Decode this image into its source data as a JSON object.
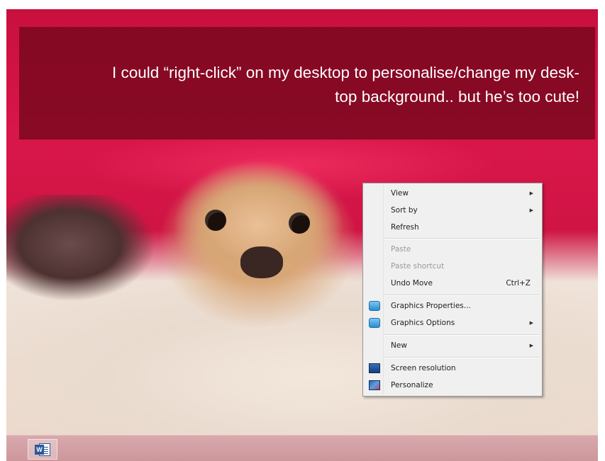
{
  "caption": {
    "line1": "I could “right-click” on my desktop to personalise/change my desk-",
    "line2": "top background.. but he’s too cute!"
  },
  "context_menu": {
    "items": [
      {
        "label": "View",
        "submenu": true
      },
      {
        "label": "Sort by",
        "submenu": true
      },
      {
        "label": "Refresh"
      },
      {
        "label": "Paste",
        "disabled": true
      },
      {
        "label": "Paste shortcut",
        "disabled": true
      },
      {
        "label": "Undo Move",
        "shortcut": "Ctrl+Z"
      },
      {
        "label": "Graphics Properties...",
        "icon": "graphics-icon"
      },
      {
        "label": "Graphics Options",
        "icon": "graphics-icon",
        "submenu": true
      },
      {
        "label": "New",
        "submenu": true
      },
      {
        "label": "Screen resolution",
        "icon": "screen-resolution-icon"
      },
      {
        "label": "Personalize",
        "icon": "personalize-icon"
      }
    ],
    "submenu_arrow": "▶"
  },
  "taskbar": {
    "word_icon_letter": "W",
    "word_icon": "word-icon"
  },
  "colors": {
    "caption_bg": "#7a0820",
    "menu_bg": "#f0f0f0",
    "taskbar": "#d0a0a4"
  }
}
